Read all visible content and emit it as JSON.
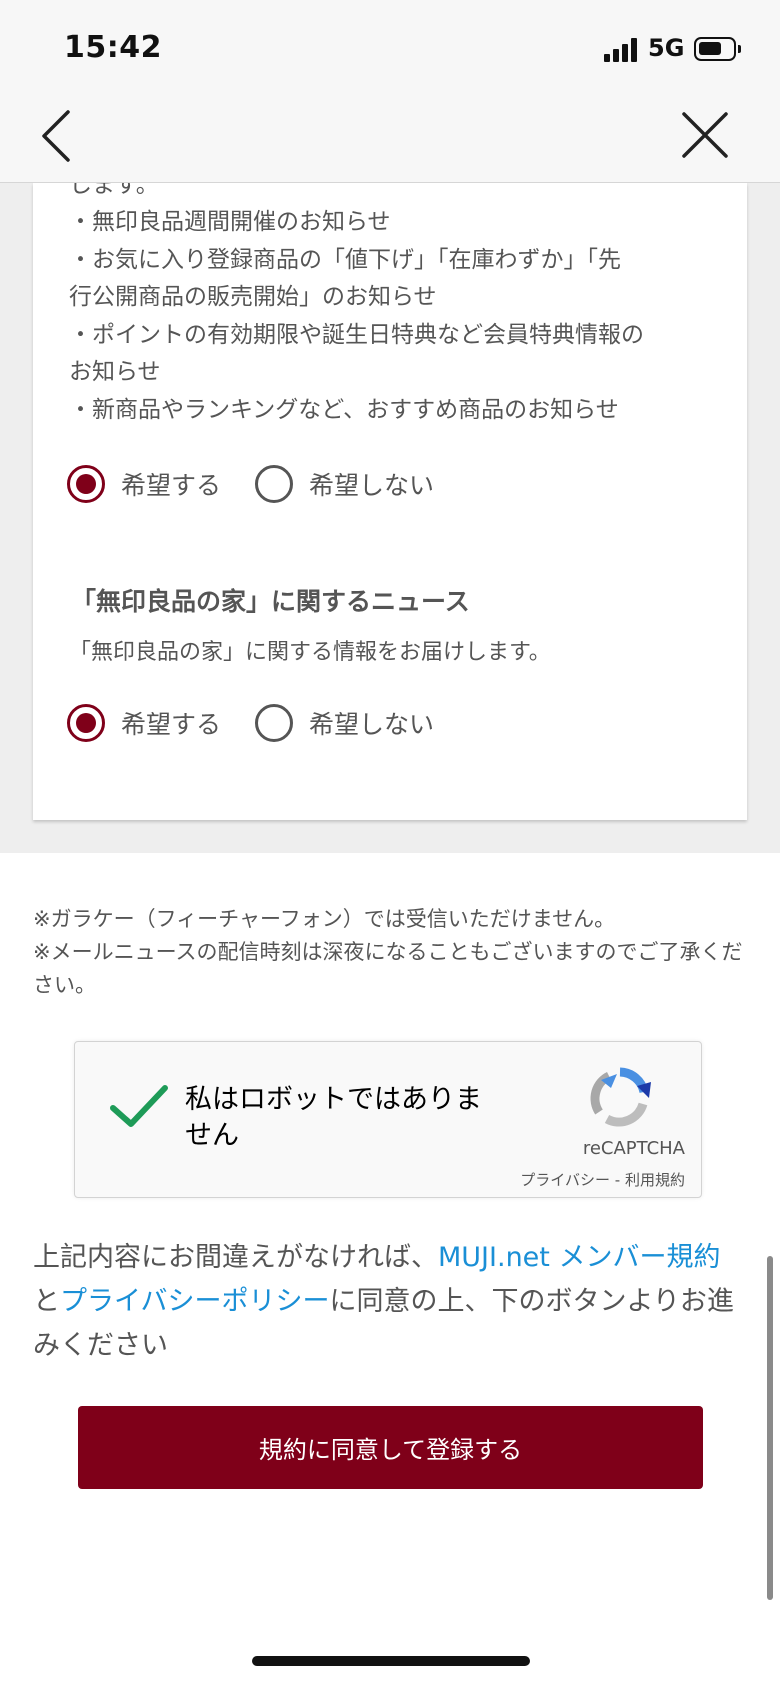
{
  "status_bar": {
    "time": "15:42",
    "network": "5G"
  },
  "nav": {
    "back_icon": "chevron-left-icon",
    "close_icon": "close-x-icon"
  },
  "newsletter": {
    "lines": [
      "します。",
      "・無印良品週間開催のお知らせ",
      "・お気に入り登録商品の「値下げ」「在庫わずか」「先",
      "行公開商品の販売開始」のお知らせ",
      "・ポイントの有効期限や誕生日特典など会員特典情報の",
      "お知らせ",
      "・新商品やランキングなど、おすすめ商品のお知らせ"
    ],
    "options": {
      "yes": "希望する",
      "no": "希望しない",
      "selected": "yes"
    }
  },
  "muji_house": {
    "title": "「無印良品の家」に関するニュース",
    "description": "「無印良品の家」に関する情報をお届けします。",
    "options": {
      "yes": "希望する",
      "no": "希望しない",
      "selected": "yes"
    }
  },
  "notes": [
    "※ガラケー（フィーチャーフォン）では受信いただけません。",
    "※メールニュースの配信時刻は深夜になることもございますのでご了承ください。"
  ],
  "recaptcha": {
    "label": "私はロボットではありません",
    "brand": "reCAPTCHA",
    "privacy": "プライバシー",
    "separator": "-",
    "terms": "利用規約",
    "checked": true
  },
  "consent": {
    "prefix": "上記内容にお間違えがなければ、",
    "link1": "MUJI.net メンバー規約",
    "middle": "と",
    "link2": "プライバシーポリシー",
    "suffix": "に同意の上、下のボタンよりお進みください"
  },
  "submit_label": "規約に同意して登録する",
  "colors": {
    "accent": "#7f0019",
    "link": "#1a8fd6",
    "check": "#1e9b58"
  }
}
